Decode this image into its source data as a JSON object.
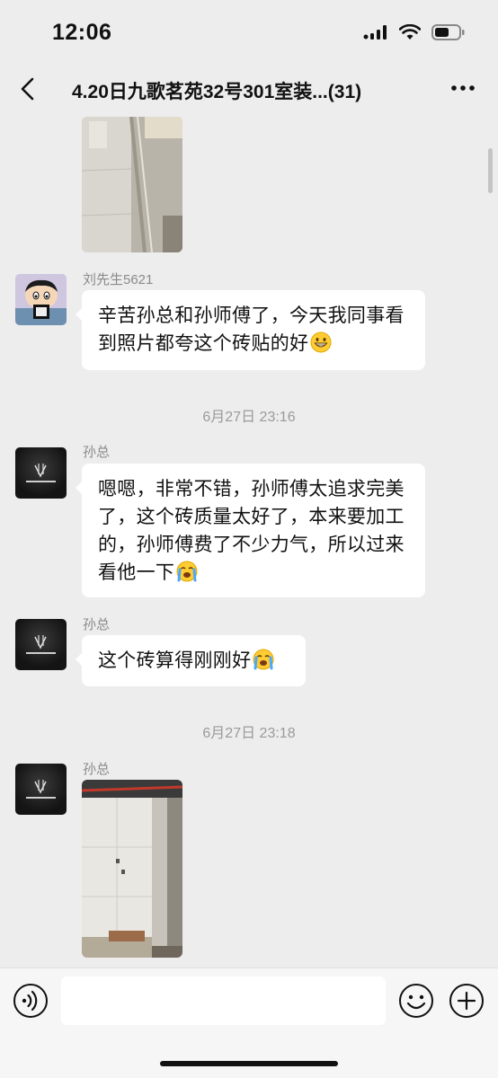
{
  "status": {
    "time": "12:06",
    "icons": [
      "cellular-signal-icon",
      "wifi-icon",
      "battery-icon"
    ]
  },
  "header": {
    "title": "4.20日九歌茗苑32号301室装...(31)",
    "back_icon": "chevron-left-icon",
    "more_icon": "ellipsis-icon"
  },
  "messages": [
    {
      "type": "image",
      "sender": "",
      "description_icon": "photo"
    },
    {
      "type": "text",
      "sender": "刘先生5621",
      "text": "辛苦孙总和孙师傅了，今天我同事看到照片都夸这个砖贴的好",
      "emoji": "grinning-face"
    },
    {
      "type": "timestamp",
      "text": "6月27日 23:16"
    },
    {
      "type": "text",
      "sender": "孙总",
      "text": "嗯嗯，非常不错，孙师傅太追求完美了，这个砖质量太好了，本来要加工的，孙师傅费了不少力气，所以过来看他一下",
      "emoji": "loudly-crying-face"
    },
    {
      "type": "text",
      "sender": "孙总",
      "text": "这个砖算得刚刚好",
      "emoji": "loudly-crying-face"
    },
    {
      "type": "timestamp",
      "text": "6月27日 23:18"
    },
    {
      "type": "image",
      "sender": "孙总"
    }
  ],
  "input_bar": {
    "placeholder": "",
    "voice_icon": "voice-icon",
    "emoji_icon": "emoji-icon",
    "plus_icon": "plus-icon"
  },
  "colors": {
    "background": "#ededed",
    "bubble": "#ffffff",
    "meta_text": "#9a9a9a"
  }
}
